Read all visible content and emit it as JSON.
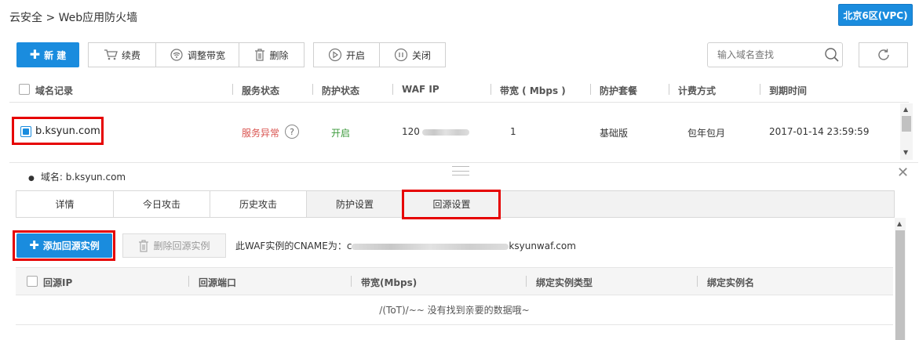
{
  "header": {
    "breadcrumb": "云安全 > Web应用防火墙",
    "region": "北京6区(VPC)"
  },
  "toolbar": {
    "new_label": "新 建",
    "renew_label": "续费",
    "bandwidth_label": "调整带宽",
    "delete_label": "删除",
    "start_label": "开启",
    "stop_label": "关闭",
    "search_placeholder": "输入域名查找"
  },
  "table": {
    "columns": [
      "域名记录",
      "服务状态",
      "防护状态",
      "WAF IP",
      "带宽 ( Mbps )",
      "防护套餐",
      "计费方式",
      "到期时间"
    ],
    "rows": [
      {
        "domain": "b.ksyun.com",
        "service_status": "服务异常",
        "protect_status": "开启",
        "waf_ip": "120",
        "bandwidth": "1",
        "package": "基础版",
        "billing": "包年包月",
        "expire": "2017-01-14 23:59:59"
      }
    ]
  },
  "detail": {
    "domain_label": "域名: b.ksyun.com",
    "tabs": [
      "详情",
      "今日攻击",
      "历史攻击",
      "防护设置",
      "回源设置"
    ],
    "active_tab": "回源设置",
    "add_origin_label": "添加回源实例",
    "delete_origin_label": "删除回源实例",
    "cname_prefix": "此WAF实例的CNAME为：c",
    "cname_suffix": "ksyunwaf.com",
    "columns": [
      "回源IP",
      "回源端口",
      "带宽(Mbps)",
      "绑定实例类型",
      "绑定实例名"
    ],
    "empty_text": "/(ToT)/~~ 没有找到亲要的数据哦~"
  },
  "colors": {
    "primary": "#1a8cde",
    "error": "#d9534f",
    "success": "#3c9a3c",
    "highlight_box": "#e60000"
  }
}
